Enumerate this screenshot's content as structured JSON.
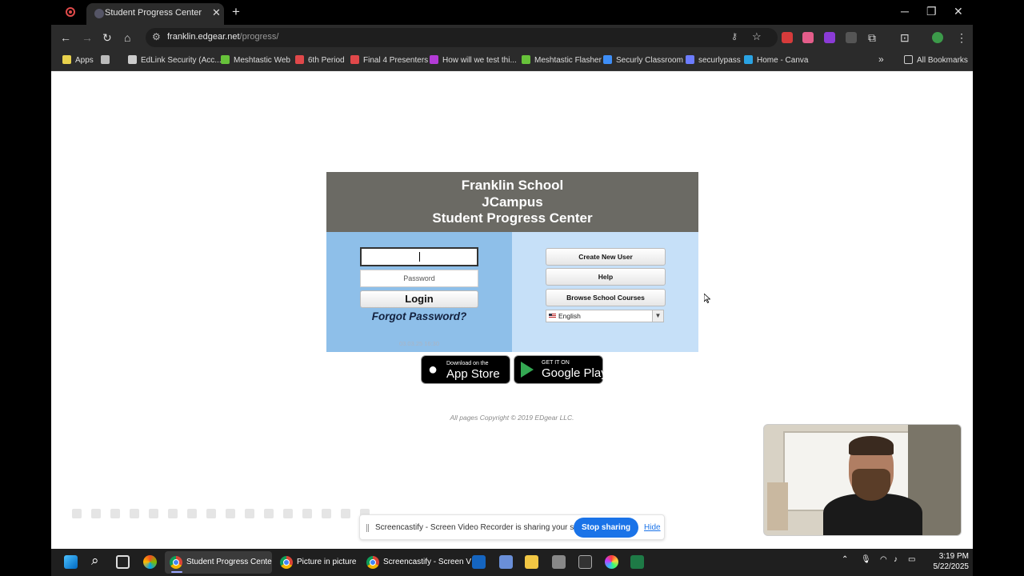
{
  "browser": {
    "tab_title": "Student Progress Center",
    "url_host": "franklin.edgear.net",
    "url_path": "/progress/",
    "bookmarks": [
      {
        "label": "Apps",
        "color": "#e8d14c"
      },
      {
        "label": "",
        "color": "#bbbbbb"
      },
      {
        "label": "EdLink Security (Acc...",
        "color": "#cccccc"
      },
      {
        "label": "Meshtastic Web",
        "color": "#67c23a"
      },
      {
        "label": "6th Period",
        "color": "#e0484a"
      },
      {
        "label": "Final 4 Presenters",
        "color": "#e0484a"
      },
      {
        "label": "How will we test thi...",
        "color": "#b33bd6"
      },
      {
        "label": "Meshtastic Flasher",
        "color": "#67c23a"
      },
      {
        "label": "Securly Classroom",
        "color": "#3e8ef7"
      },
      {
        "label": "securlypass",
        "color": "#6c7cff"
      },
      {
        "label": "Home - Canva",
        "color": "#2aa3e3"
      }
    ],
    "all_bookmarks_label": "All Bookmarks"
  },
  "login": {
    "school_name": "Franklin School",
    "system_name": "JCampus",
    "center_name": "Student Progress Center",
    "username_value": "",
    "password_placeholder": "Password",
    "login_label": "Login",
    "forgot_label": "Forgot Password?",
    "version": "03.03.25 16:30",
    "create_user_label": "Create New User",
    "help_label": "Help",
    "browse_courses_label": "Browse School Courses",
    "language_selected": "English"
  },
  "stores": {
    "apple_small": "Download on the",
    "apple_big": "App Store",
    "google_small": "GET IT ON",
    "google_big": "Google Play"
  },
  "copyright": "All pages Copyright © 2019 EDgear LLC.",
  "share_bar": {
    "message": "Screencastify - Screen Video Recorder is sharing your screen.",
    "stop_label": "Stop sharing",
    "hide_label": "Hide"
  },
  "taskbar": {
    "apps": [
      {
        "label": "Student Progress Cente",
        "active": true
      },
      {
        "label": "Picture in picture",
        "active": false
      },
      {
        "label": "Screencastify - Screen V",
        "active": false
      }
    ],
    "time": "3:19 PM",
    "date": "5/22/2025"
  },
  "colors": {
    "header_bg": "#6b6a64",
    "left_panel": "#8ebfe9",
    "right_panel": "#c6e0f8",
    "stop_button": "#1a73e8"
  }
}
